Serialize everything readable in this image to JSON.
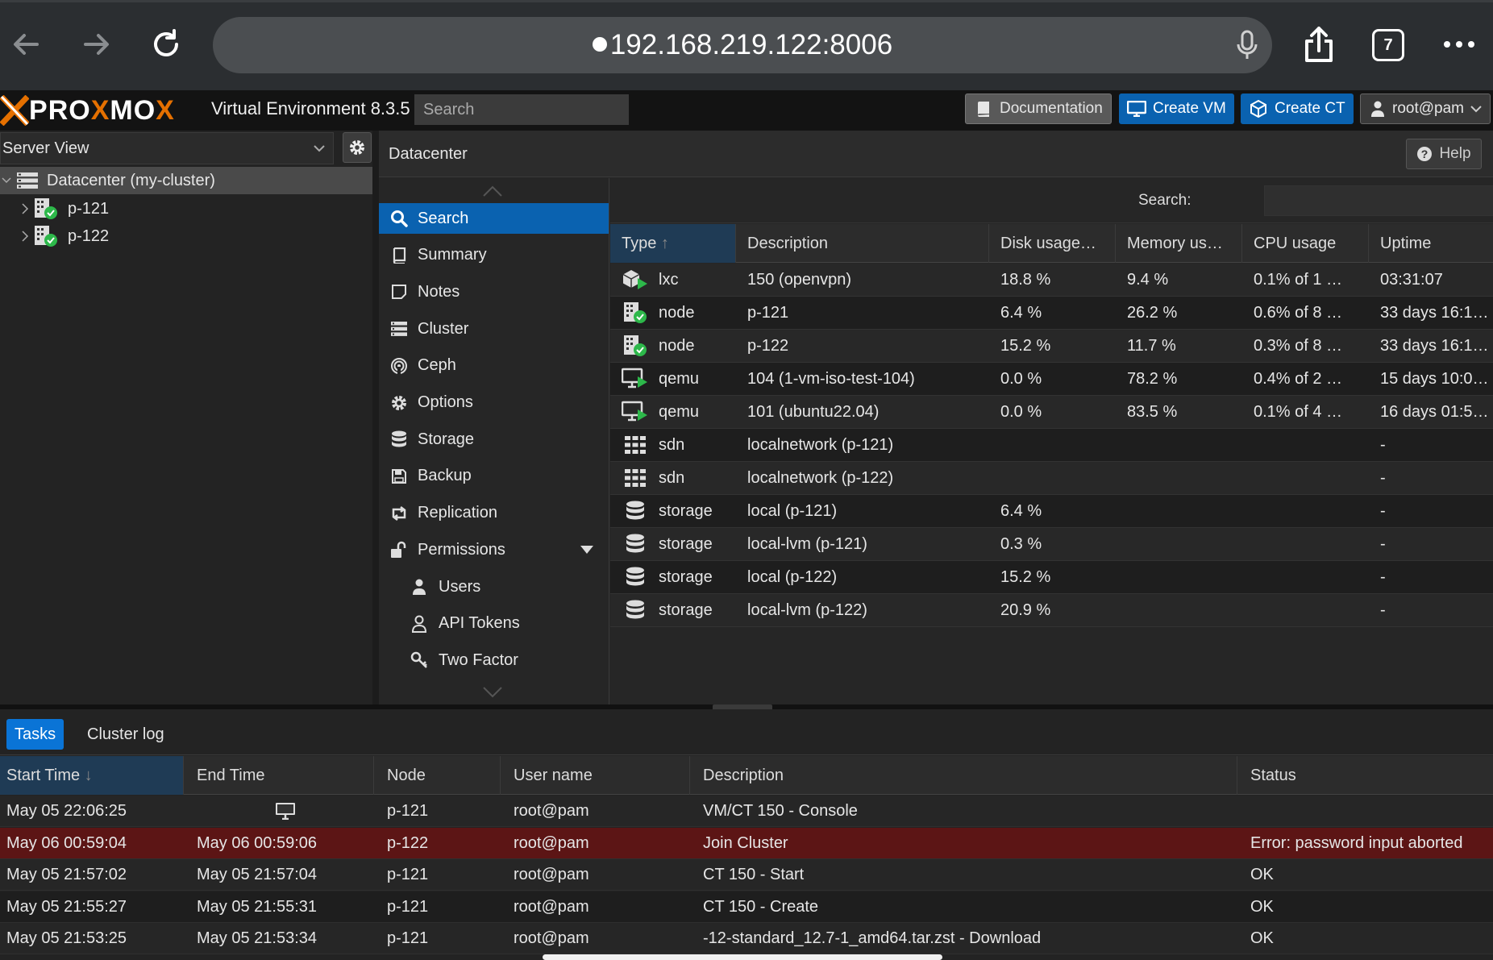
{
  "browser": {
    "url": "192.168.219.122:8006",
    "tab_count": "7"
  },
  "header": {
    "logo": "PROXMOX",
    "version": "Virtual Environment 8.3.5",
    "search_placeholder": "Search",
    "documentation_label": "Documentation",
    "create_vm_label": "Create VM",
    "create_ct_label": "Create CT",
    "user_label": "root@pam"
  },
  "tree": {
    "view_label": "Server View",
    "items": [
      {
        "label": "Datacenter (my-cluster)"
      },
      {
        "label": "p-121"
      },
      {
        "label": "p-122"
      }
    ]
  },
  "content": {
    "title": "Datacenter",
    "help_label": "Help"
  },
  "menu": {
    "items": [
      {
        "label": "Search",
        "icon": "search-icon"
      },
      {
        "label": "Summary",
        "icon": "book-icon"
      },
      {
        "label": "Notes",
        "icon": "note-icon"
      },
      {
        "label": "Cluster",
        "icon": "server-icon"
      },
      {
        "label": "Ceph",
        "icon": "ceph-icon"
      },
      {
        "label": "Options",
        "icon": "gear-icon"
      },
      {
        "label": "Storage",
        "icon": "database-icon"
      },
      {
        "label": "Backup",
        "icon": "floppy-icon"
      },
      {
        "label": "Replication",
        "icon": "retweet-icon"
      },
      {
        "label": "Permissions",
        "icon": "unlock-icon"
      },
      {
        "label": "Users",
        "icon": "user-icon"
      },
      {
        "label": "API Tokens",
        "icon": "user-outline-icon"
      },
      {
        "label": "Two Factor",
        "icon": "key-icon"
      }
    ]
  },
  "grid": {
    "search_label": "Search:",
    "columns": [
      "Type",
      "Description",
      "Disk usage…",
      "Memory us…",
      "CPU usage",
      "Uptime"
    ],
    "rows": [
      {
        "icon": "lxc-running-icon",
        "type": "lxc",
        "description": "150 (openvpn)",
        "disk": "18.8 %",
        "memory": "9.4 %",
        "cpu": "0.1% of 1 …",
        "uptime": "03:31:07"
      },
      {
        "icon": "node-online-icon",
        "type": "node",
        "description": "p-121",
        "disk": "6.4 %",
        "memory": "26.2 %",
        "cpu": "0.6% of 8 …",
        "uptime": "33 days 16:1…"
      },
      {
        "icon": "node-online-icon",
        "type": "node",
        "description": "p-122",
        "disk": "15.2 %",
        "memory": "11.7 %",
        "cpu": "0.3% of 8 …",
        "uptime": "33 days 16:1…"
      },
      {
        "icon": "qemu-running-icon",
        "type": "qemu",
        "description": "104 (1-vm-iso-test-104)",
        "disk": "0.0 %",
        "memory": "78.2 %",
        "cpu": "0.4% of 2 …",
        "uptime": "15 days 10:0…"
      },
      {
        "icon": "qemu-running-icon",
        "type": "qemu",
        "description": "101 (ubuntu22.04)",
        "disk": "0.0 %",
        "memory": "83.5 %",
        "cpu": "0.1% of 4 …",
        "uptime": "16 days 01:5…"
      },
      {
        "icon": "sdn-icon",
        "type": "sdn",
        "description": "localnetwork (p-121)",
        "disk": "",
        "memory": "",
        "cpu": "",
        "uptime": "-"
      },
      {
        "icon": "sdn-icon",
        "type": "sdn",
        "description": "localnetwork (p-122)",
        "disk": "",
        "memory": "",
        "cpu": "",
        "uptime": "-"
      },
      {
        "icon": "storage-icon",
        "type": "storage",
        "description": "local (p-121)",
        "disk": "6.4 %",
        "memory": "",
        "cpu": "",
        "uptime": "-"
      },
      {
        "icon": "storage-icon",
        "type": "storage",
        "description": "local-lvm (p-121)",
        "disk": "0.3 %",
        "memory": "",
        "cpu": "",
        "uptime": "-"
      },
      {
        "icon": "storage-icon",
        "type": "storage",
        "description": "local (p-122)",
        "disk": "15.2 %",
        "memory": "",
        "cpu": "",
        "uptime": "-"
      },
      {
        "icon": "storage-icon",
        "type": "storage",
        "description": "local-lvm (p-122)",
        "disk": "20.9 %",
        "memory": "",
        "cpu": "",
        "uptime": "-"
      }
    ]
  },
  "tasks": {
    "tabs": [
      "Tasks",
      "Cluster log"
    ],
    "columns": [
      "Start Time",
      "End Time",
      "Node",
      "User name",
      "Description",
      "Status"
    ],
    "rows": [
      {
        "start": "May 05 22:06:25",
        "end": "",
        "node": "p-121",
        "user": "root@pam",
        "description": "VM/CT 150 - Console",
        "status": ""
      },
      {
        "start": "May 06 00:59:04",
        "end": "May 06 00:59:06",
        "node": "p-122",
        "user": "root@pam",
        "description": "Join Cluster",
        "status": "Error: password input aborted"
      },
      {
        "start": "May 05 21:57:02",
        "end": "May 05 21:57:04",
        "node": "p-121",
        "user": "root@pam",
        "description": "CT 150 - Start",
        "status": "OK"
      },
      {
        "start": "May 05 21:55:27",
        "end": "May 05 21:55:31",
        "node": "p-121",
        "user": "root@pam",
        "description": "CT 150 - Create",
        "status": "OK"
      },
      {
        "start": "May 05 21:53:25",
        "end": "May 05 21:53:34",
        "node": "p-121",
        "user": "root@pam",
        "description": "-12-standard_12.7-1_amd64.tar.zst - Download",
        "status": "OK"
      }
    ]
  },
  "colors": {
    "accent_blue": "#0a62b0",
    "logo_orange": "#e57000",
    "status_green": "#2db84a",
    "error_row": "#5c1515"
  }
}
